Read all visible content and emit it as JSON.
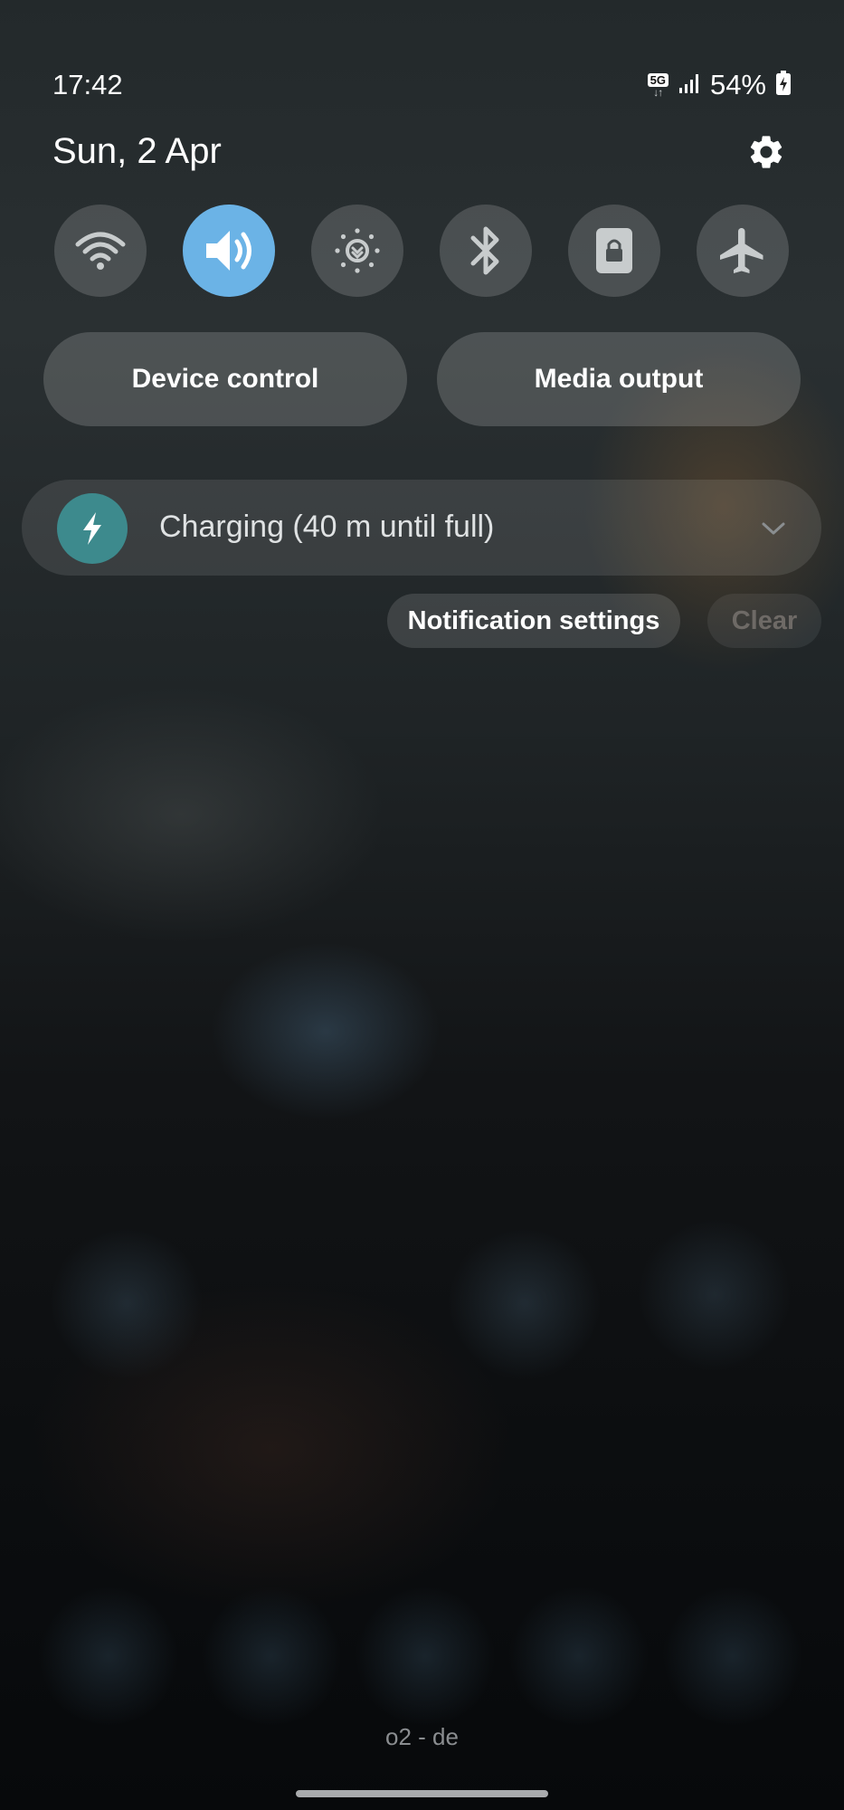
{
  "status_bar": {
    "time": "17:42",
    "network_type": "5G",
    "network_arrows": "↓↑",
    "signal_icon": "cellular-signal-icon",
    "battery_percent": "54%",
    "battery_icon": "battery-charging-icon"
  },
  "header": {
    "date": "Sun, 2 Apr",
    "settings_icon": "gear-icon"
  },
  "quick_toggles": [
    {
      "name": "Wi-Fi",
      "icon": "wifi-icon",
      "active": false
    },
    {
      "name": "Sound",
      "icon": "volume-icon",
      "active": true
    },
    {
      "name": "Eye comfort",
      "icon": "brightness-icon",
      "active": false
    },
    {
      "name": "Bluetooth",
      "icon": "bluetooth-icon",
      "active": false
    },
    {
      "name": "Portrait",
      "icon": "rotation-lock-icon",
      "active": false
    },
    {
      "name": "Airplane mode",
      "icon": "airplane-icon",
      "active": false
    }
  ],
  "pills": {
    "device_control": "Device control",
    "media_output": "Media output"
  },
  "notification": {
    "icon": "lightning-bolt-icon",
    "text": "Charging (40 m until full)",
    "expand_icon": "chevron-down-icon"
  },
  "notification_actions": {
    "settings": "Notification settings",
    "clear": "Clear"
  },
  "footer": {
    "carrier": "o2 - de"
  },
  "colors": {
    "active_toggle": "#6bb3e6",
    "charging_icon_bg": "#3d8a8d",
    "clear_text": "#6e6a66"
  }
}
